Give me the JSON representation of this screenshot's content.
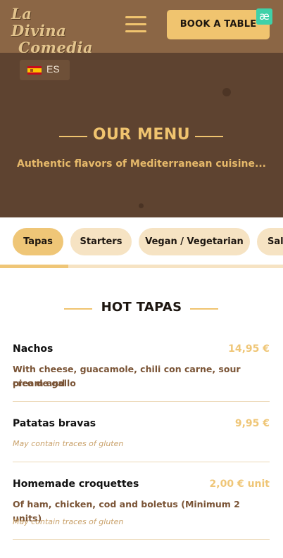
{
  "header": {
    "logo_line1": "La Divina",
    "logo_line2": "Comedia",
    "book_label": "BOOK A TABLE",
    "badge": "æ"
  },
  "hero": {
    "language": "ES",
    "title": "OUR MENU",
    "subtitle": "Authentic flavors of Mediterranean cuisine..."
  },
  "tabs": [
    {
      "label": "Tapas",
      "active": true
    },
    {
      "label": "Starters",
      "active": false
    },
    {
      "label": "Vegan / Vegetarian",
      "active": false
    },
    {
      "label": "Sal",
      "active": false
    }
  ],
  "section": {
    "title": "HOT TAPAS"
  },
  "items": [
    {
      "name": "Nachos",
      "price": "14,95 €",
      "description_line1": "With cheese, guacamole, chili con carne, sour cream and",
      "description_line2": "pico de gallo",
      "note": ""
    },
    {
      "name": "Patatas bravas",
      "price": "9,95 €",
      "description_line1": "",
      "description_line2": "",
      "note": "May contain traces of gluten"
    },
    {
      "name": "Homemade croquettes",
      "price": "2,00 € unit",
      "description_line1": "Of ham, chicken, cod and boletus (Minimum 2 units)",
      "description_line2": "",
      "note": "May contain traces of gluten"
    }
  ],
  "colors": {
    "header_bg": "#8b6645",
    "hero_bg": "#5e4330",
    "accent": "#f0c46f",
    "tab_bg": "#f6e3c3",
    "price": "#efc677"
  }
}
